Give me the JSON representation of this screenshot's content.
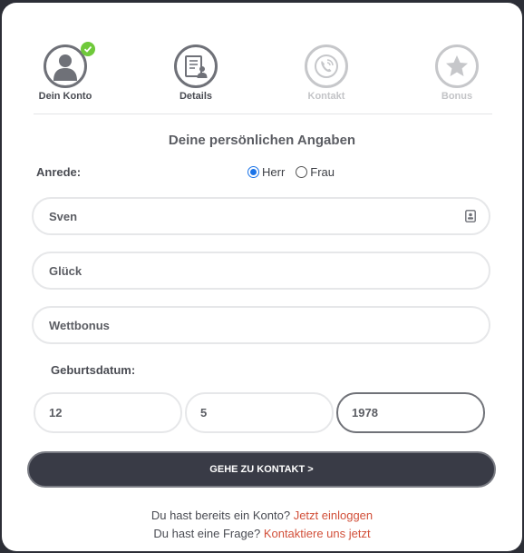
{
  "steps": [
    {
      "label": "Dein Konto",
      "icon": "user-icon",
      "state": "done"
    },
    {
      "label": "Details",
      "icon": "document-user-icon",
      "state": "current"
    },
    {
      "label": "Kontakt",
      "icon": "phone-icon",
      "state": "inactive"
    },
    {
      "label": "Bonus",
      "icon": "star-icon",
      "state": "inactive"
    }
  ],
  "section_title": "Deine persönlichen Angaben",
  "anrede": {
    "label": "Anrede:",
    "options": [
      {
        "label": "Herr",
        "checked": true
      },
      {
        "label": "Frau",
        "checked": false
      }
    ]
  },
  "fields": {
    "first_name": "Sven",
    "last_name": "Glück",
    "username": "Wettbonus"
  },
  "birthdate": {
    "label": "Geburtsdatum:",
    "day": "12",
    "month": "5",
    "year": "1978"
  },
  "cta_label": "GEHE ZU KONTAKT >",
  "footer": {
    "login_text": "Du hast bereits ein Konto?",
    "login_link": "Jetzt einloggen",
    "question_text": "Du hast eine Frage?",
    "contact_link": "Kontaktiere uns jetzt"
  },
  "colors": {
    "accent_link": "#d2503a",
    "success": "#6fc93a",
    "button_bg": "#393b46",
    "radio_checked": "#1a73e8"
  }
}
